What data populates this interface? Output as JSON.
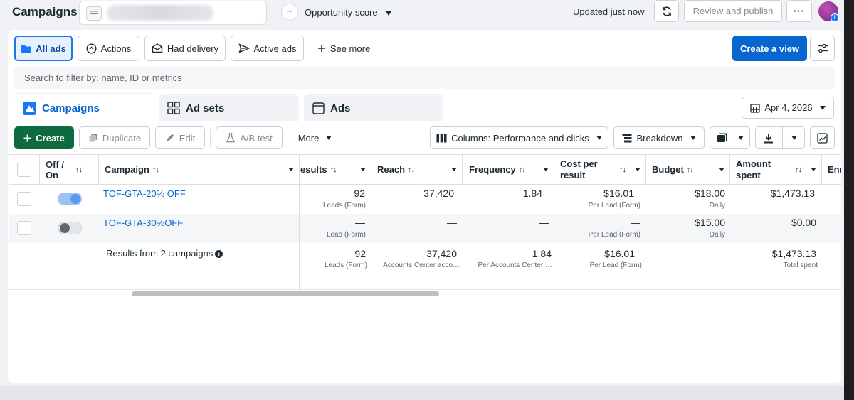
{
  "header": {
    "title": "Campaigns",
    "opportunity_label": "Opportunity score",
    "opportunity_dots": "--",
    "updated": "Updated just now",
    "review_publish": "Review and publish"
  },
  "filters": {
    "all_ads": "All ads",
    "actions": "Actions",
    "had_delivery": "Had delivery",
    "active_ads": "Active ads",
    "see_more": "See more",
    "create_view": "Create a view"
  },
  "search": {
    "placeholder": "Search to filter by: name, ID or metrics"
  },
  "tabs": [
    {
      "label": "Campaigns"
    },
    {
      "label": "Ad sets"
    },
    {
      "label": "Ads"
    }
  ],
  "date_range": "Apr 4, 2026",
  "toolbar": {
    "create": "Create",
    "duplicate": "Duplicate",
    "edit": "Edit",
    "ab_test": "A/B test",
    "more": "More",
    "columns": "Columns: Performance and clicks",
    "breakdown": "Breakdown"
  },
  "columns": {
    "off_on": "Off / On",
    "campaign": "Campaign",
    "results": "esults",
    "reach": "Reach",
    "frequency": "Frequency",
    "cost_per_result": "Cost per result",
    "budget": "Budget",
    "amount_spent": "Amount spent",
    "ends": "End"
  },
  "rows": [
    {
      "name": "TOF-GTA-20% OFF",
      "enabled": true,
      "results": "92",
      "results_sub": "Leads (Form)",
      "reach": "37,420",
      "frequency": "1.84",
      "cost": "$16.01",
      "cost_sub": "Per Lead (Form)",
      "budget": "$18.00",
      "budget_sub": "Daily",
      "spent": "$1,473.13"
    },
    {
      "name": "TOF-GTA-30%OFF",
      "enabled": false,
      "results": "—",
      "results_sub": "Lead (Form)",
      "reach": "—",
      "frequency": "—",
      "cost": "—",
      "cost_sub": "Per Lead (Form)",
      "budget": "$15.00",
      "budget_sub": "Daily",
      "spent": "$0.00"
    }
  ],
  "summary": {
    "label": "Results from 2 campaigns",
    "results": "92",
    "results_sub": "Leads (Form)",
    "reach": "37,420",
    "reach_sub": "Accounts Center acco…",
    "frequency": "1.84",
    "frequency_sub": "Per Accounts Center …",
    "cost": "$16.01",
    "cost_sub": "Per Lead (Form)",
    "spent": "$1,473.13",
    "spent_sub": "Total spent"
  },
  "colors": {
    "primary": "#0866d1",
    "create_green": "#0e6b3f",
    "text": "#1c2b33"
  },
  "icons": [
    "refresh-icon",
    "more-icon",
    "avatar",
    "folder-icon",
    "actions-icon",
    "delivery-icon",
    "send-icon",
    "plus-icon",
    "settings-icon",
    "campaigns-icon",
    "grid-icon",
    "square-icon",
    "calendar-icon",
    "duplicate-icon",
    "pencil-icon",
    "flask-icon",
    "columns-icon",
    "breakdown-icon",
    "reports-icon",
    "download-icon",
    "chart-icon",
    "info-icon"
  ]
}
